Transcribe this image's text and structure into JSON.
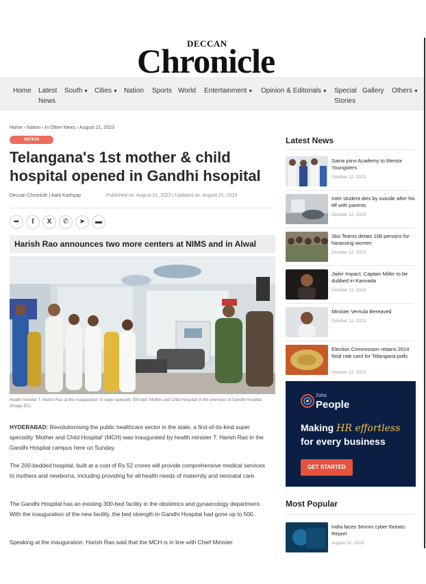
{
  "masthead": {
    "top": "DECCAN",
    "name": "Chronicle"
  },
  "nav": [
    {
      "label": "Home"
    },
    {
      "label": "Latest News"
    },
    {
      "label": "South"
    },
    {
      "label": "Cities"
    },
    {
      "label": "Nation"
    },
    {
      "label": "Sports"
    },
    {
      "label": "World"
    },
    {
      "label": "Entertainment"
    },
    {
      "label": "Opinion & Editorials"
    },
    {
      "label": "Special Stories"
    },
    {
      "label": "Gallery"
    },
    {
      "label": "Others"
    }
  ],
  "article": {
    "breadcrumb": "Home › Nation › In Other News › August 21, 2023",
    "badge": "NATION",
    "headline": "Telangana's 1st mother & child hospital opened in Gandhi hsopital",
    "byline": "Deccan Chronicle | Aarti Kashyap",
    "dates": "Published on: August 21, 2023 | Updated on: August 21, 2023",
    "subhead": "Harish Rao announces two more centers at NIMS and in Alwal",
    "caption": "Health minister T. Harish Rao at the inauguration of super specialty 300-bed 'Mother and Child Hospital' in the premises of Gandhi Hospital. (Image DC)",
    "p1_lead": "HYDERABAD:",
    "p1": " Revolutionising the public healthcare sector in the state, a first-of-its-kind super speciality 'Mother and Child Hospital' (MCH) was inaugurated by health minister T. Harish Rao in the Gandhi Hospital campus here on Sunday.",
    "p2": "The 200-bedded hospital, built at a cost of Rs 52 crores will provide comprehensive medical services to mothers and newborns, including providing for all health needs of maternity and neonatal care.",
    "p3": "The Gandhi Hospital has an existing 300-bed facility in the obstetrics and gynaecology department. With the inauguration of the new facility, the bed strength in Gandhi Hospital had gone up to 500.",
    "p4": "Speaking at the inauguration, Harish Rao said that the MCH is in line with Chief Minister"
  },
  "sidebar": {
    "latest_title": "Latest News",
    "latest": [
      {
        "title": "Saina joins Academy to Mentor Youngsters",
        "date": "October 12, 2023"
      },
      {
        "title": "Inter student dies by suicide after his tiff with parents",
        "date": "October 12, 2023"
      },
      {
        "title": "Sko Teams detain 108 persons for harassing women",
        "date": "October 12, 2023"
      },
      {
        "title": "Jailer Impact: Captain Miller to be dubbed in Kannada",
        "date": "October 12, 2023"
      },
      {
        "title": "Minister Vemula Bereaved",
        "date": "October 12, 2023"
      },
      {
        "title": "Election Commission retains 2014 food rate card for Telangana polls",
        "date": "October 12, 2023"
      }
    ],
    "ad": {
      "brand_small": "Zoho",
      "brand": "People",
      "line1_a": "Making ",
      "line1_b": "HR effortless",
      "line2": "for every business",
      "cta": "GET STARTED",
      "bg": "#0b1f45"
    },
    "popular_title": "Most Popular",
    "popular": [
      {
        "title": "India faces 3mmm cyber threats: Report",
        "date": "August 31, 2023"
      }
    ]
  }
}
